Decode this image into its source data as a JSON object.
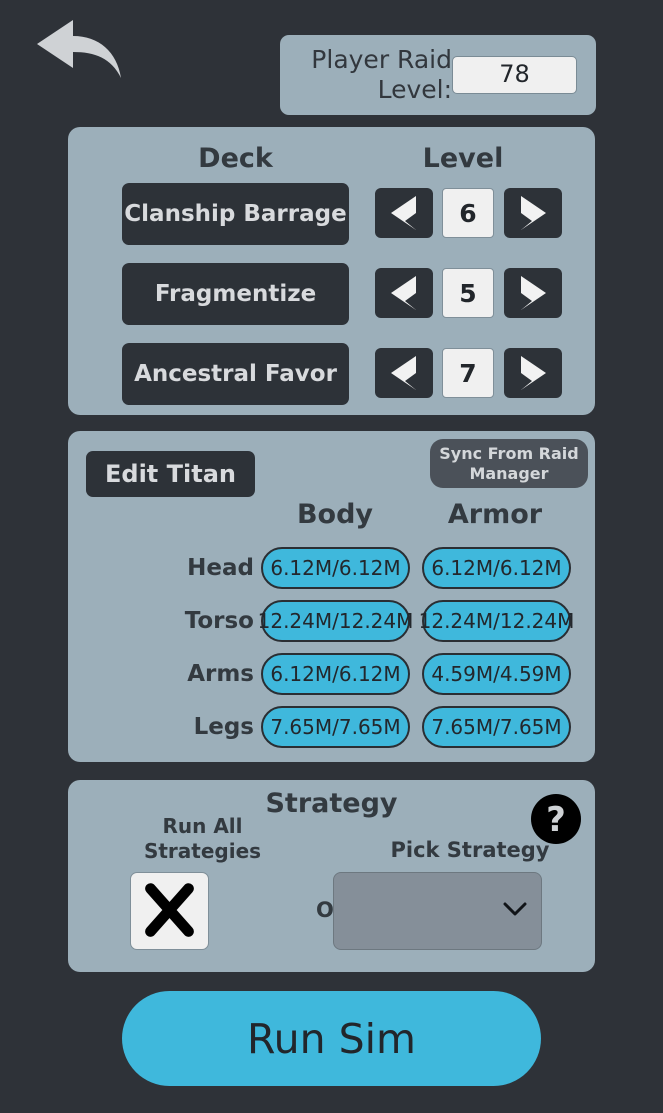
{
  "header": {
    "back_icon": "back-arrow-icon",
    "raid_level_label": "Player Raid Level:",
    "raid_level_value": "78"
  },
  "deck_panel": {
    "col_deck": "Deck",
    "col_level": "Level",
    "prev_icon": "chevron-left-icon",
    "next_icon": "chevron-right-icon",
    "rows": [
      {
        "name": "Clanship Barrage",
        "level": "6"
      },
      {
        "name": "Fragmentize",
        "level": "5"
      },
      {
        "name": "Ancestral Favor",
        "level": "7"
      }
    ]
  },
  "titan_panel": {
    "edit_button": "Edit Titan",
    "sync_button": "Sync From Raid Manager",
    "col_body": "Body",
    "col_armor": "Armor",
    "rows": [
      {
        "part": "Head",
        "body": "6.12M/6.12M",
        "armor": "6.12M/6.12M"
      },
      {
        "part": "Torso",
        "body": "12.24M/12.24M",
        "armor": "12.24M/12.24M"
      },
      {
        "part": "Arms",
        "body": "6.12M/6.12M",
        "armor": "4.59M/4.59M"
      },
      {
        "part": "Legs",
        "body": "7.65M/7.65M",
        "armor": "7.65M/7.65M"
      }
    ]
  },
  "strategy_panel": {
    "title": "Strategy",
    "help_icon": "question-mark-icon",
    "run_all_label": "Run All Strategies",
    "run_all_checked": true,
    "check_icon": "x-mark-icon",
    "or_label": "OR",
    "pick_label": "Pick Strategy",
    "pick_value": "",
    "pick_options": [],
    "chevron_icon": "chevron-down-icon"
  },
  "run_sim": {
    "label": "Run Sim"
  },
  "colors": {
    "background": "#2e3238",
    "panel": "#9cafba",
    "dark_button": "#2d3238",
    "accent_cyan": "#3fb8dc",
    "select_grey": "#858f99",
    "sync_grey": "#4b5159",
    "text_dark": "#333a40",
    "text_light": "#d8dadd",
    "field_white": "#f0f0f0"
  }
}
